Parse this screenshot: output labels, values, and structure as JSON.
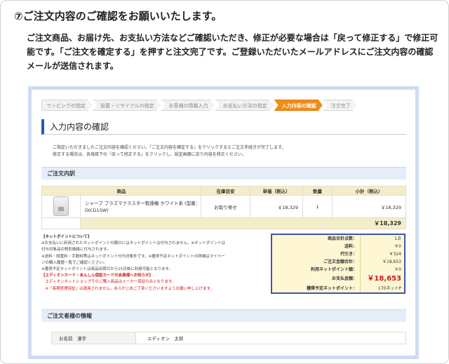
{
  "step_heading": "⑦ご注文内容のご確認をお願いいたします。",
  "intro": "ご注文商品、お届け先、お支払い方法などご確認いただき、修正が必要な場合は「戻って修正する」で修正可能です。「ご注文を確定する」を押すと注文完了です。ご登録いただいたメールアドレスにご注文内容の確認メールが送信されます。",
  "steps": [
    "ラッピングの指定",
    "設置・リサイクルの指定",
    "お客様の情報入力",
    "お支払い方法の指定",
    "入力内容の確認",
    "注文完了"
  ],
  "page_title": "入力内容の確認",
  "notice_lines": [
    "ご指定いただきましたご注文内容を確認ください。「ご注文内容を確定する」をクリックするとご注文手続きが完了します。",
    "修正する場合は、各項目下の「戻って修正する」をクリックし、設定画面に戻り内容を修正ください。"
  ],
  "order_section_title": "ご注文内訳",
  "table": {
    "headers": [
      "商品",
      "在庫目安",
      "単価（税込）",
      "数量",
      "小計（税込）"
    ],
    "item": {
      "name": "シャープ プラズマクラスター乾燥機 ホワイト系 (型番：DICD1SW)",
      "stock": "お取り寄せ",
      "price": "￥18,329",
      "qty": "1",
      "subtotal": "￥18,329"
    },
    "total": "￥18,329"
  },
  "points_info": {
    "title": "【ネットポイントについて】",
    "lines": [
      "※お支払いに利用されたネットポイントの額分にはネットポイントは付与されません。※ネットポイントは",
      "付与対象品の税別価格に付与されます。",
      "※送料・設置料・手数料等はネットポイント付与対象外です。※獲得予定ネットポイントの詳細はマイペー",
      "ジの購入履歴一覧でご確認ください。",
      "※獲得予定ネットポイントは商品出荷日から15日後に利用可能となります。"
    ],
    "red_lines": [
      "【エディオンカード・あんしん保証カードの会員様へお知らせ】",
      "　エディオンネットショップでのご購入商品はメーカー保証のみとなります。",
      "　※「長期修理保証」は適用されません。あらかじめご了承くださいますようお願い申し上げます。"
    ]
  },
  "summary": [
    {
      "key": "商品合計点数：",
      "value": "1点"
    },
    {
      "key": "送料：",
      "value": "￥0"
    },
    {
      "key": "代引き：",
      "value": "￥324"
    },
    {
      "key": "ご注文金額合計：",
      "value": "￥18,653"
    },
    {
      "key": "利用ネットポイント額：",
      "value": "￥0"
    },
    {
      "key": "お支払金額：",
      "value": "￥18,653"
    },
    {
      "key": "獲得予定ネットポイント：",
      "value": "170ネットP"
    }
  ],
  "customer_section_title": "ご注文者様の情報",
  "customer": {
    "label": "お名前　漢字",
    "value": "エディオン　太郎"
  }
}
